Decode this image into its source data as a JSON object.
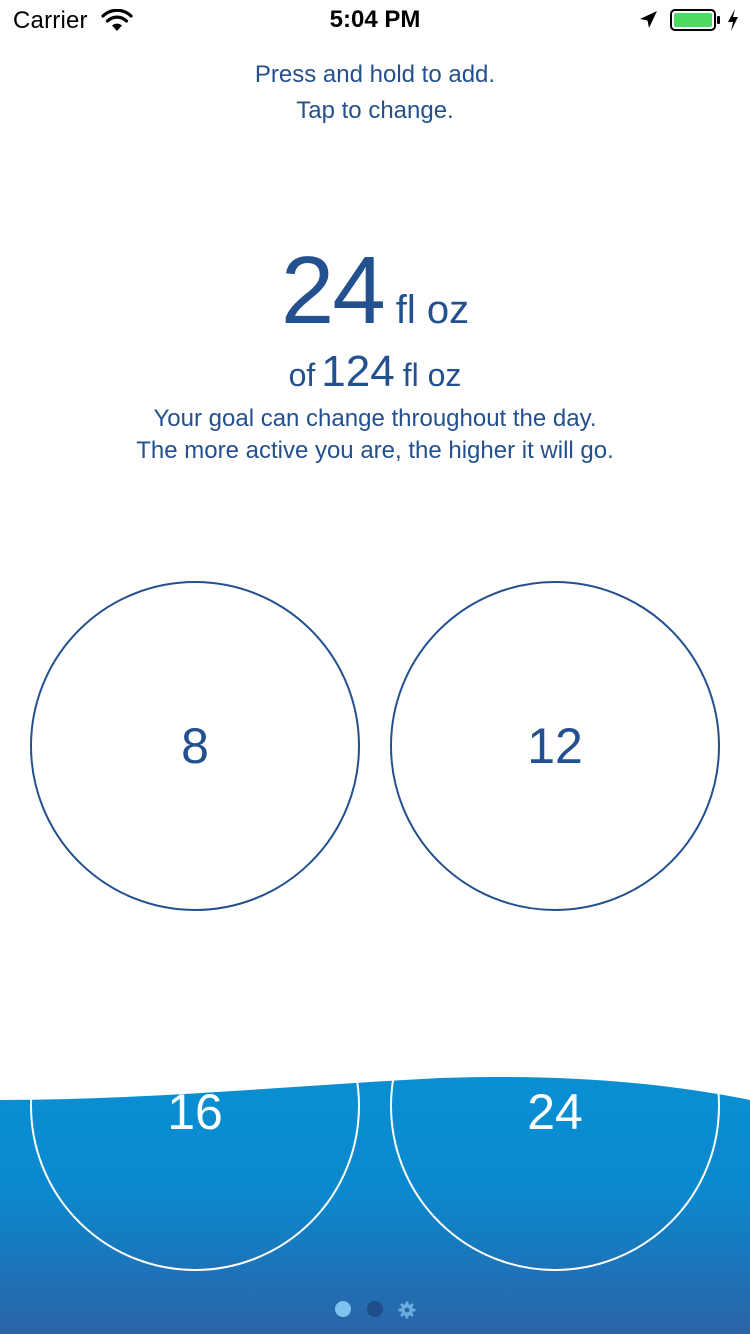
{
  "status_bar": {
    "carrier": "Carrier",
    "time": "5:04 PM",
    "wifi_icon": "wifi-icon",
    "location_icon": "location-arrow-icon",
    "battery_icon": "battery-charging-icon",
    "battery_color": "#4cd964"
  },
  "instructions": {
    "line1": "Press and hold to add.",
    "line2": "Tap to change."
  },
  "intake": {
    "value": "24",
    "unit": "fl oz"
  },
  "goal": {
    "prefix": "of",
    "value": "124",
    "unit": "fl oz",
    "note_line1": "Your goal can change throughout the day.",
    "note_line2": "The more active you are, the higher it will go."
  },
  "quick_add": [
    {
      "label": "8"
    },
    {
      "label": "12"
    },
    {
      "label": "16"
    },
    {
      "label": "24"
    }
  ],
  "pager": {
    "pages": 3,
    "current_page": 1,
    "settings_icon": "gear-icon"
  },
  "colors": {
    "primary_text": "#23508e",
    "water_top": "#0b8fd4",
    "water_bottom": "#2a64a8",
    "dot_active": "#7fc3ef",
    "dot_inactive": "#1f4e8a"
  }
}
